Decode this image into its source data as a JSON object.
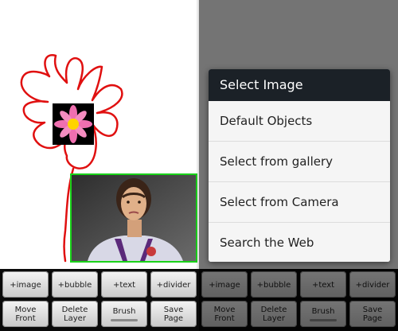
{
  "colors": {
    "stroke": "#e01010",
    "photo_border": "#19d219",
    "petal": "#f06fb0",
    "flower_center": "#ffd400",
    "dialog_header": "#1b2127",
    "toolbar_bg": "#0a0a0a"
  },
  "icons": {
    "flower_sticker": "pink-flower-icon",
    "photo": "photo-image"
  },
  "toolbar": {
    "image_label": "+image",
    "bubble_label": "+bubble",
    "text_label": "+text",
    "divider_label": "+divider",
    "move_front_label": "Move\nFront",
    "delete_layer_label": "Delete\nLayer",
    "brush_label": "Brush",
    "save_page_label": "Save\nPage"
  },
  "dialog": {
    "title": "Select Image",
    "items": [
      "Default Objects",
      "Select from gallery",
      "Select from Camera",
      "Search the Web"
    ]
  }
}
